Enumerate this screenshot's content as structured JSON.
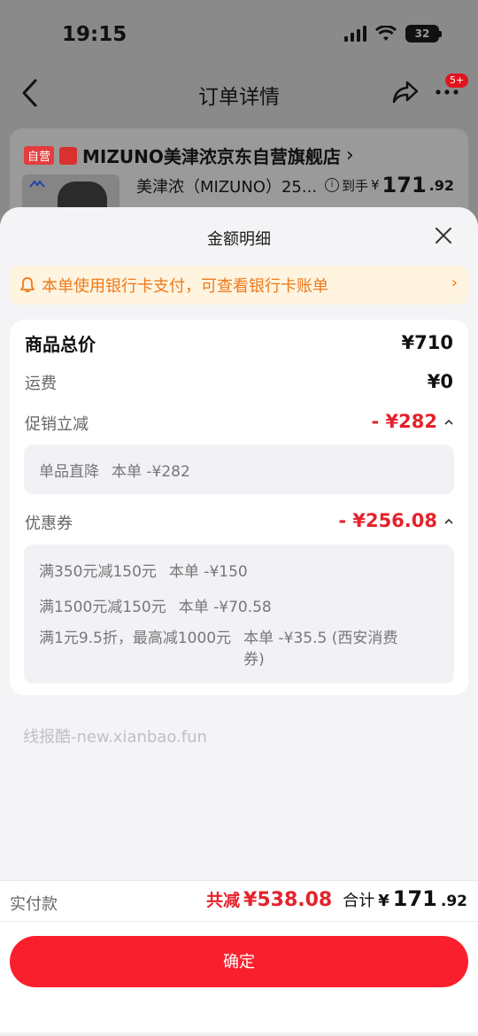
{
  "status_bar": {
    "time": "19:15",
    "battery_level": "32"
  },
  "nav": {
    "title": "订单详情",
    "more_badge": "5+"
  },
  "order": {
    "self_tag": "自营",
    "store_name": "MIZUNO美津浓京东自营旗舰店",
    "product_name": "美津浓（MIZUNO）25...",
    "price_prefix": "到手",
    "price_symbol": "¥",
    "price_int": "171",
    "price_dec": ".92"
  },
  "sheet": {
    "title": "金额明细",
    "notice": "本单使用银行卡支付，可查看银行卡账单",
    "goods_total_label": "商品总价",
    "goods_total_value": "¥710",
    "shipping_label": "运费",
    "shipping_value": "¥0",
    "promo_label": "促销立减",
    "promo_value": "- ¥282",
    "promo_items": [
      {
        "name": "单品直降",
        "amount": "本单 -¥282"
      }
    ],
    "coupon_label": "优惠券",
    "coupon_value": "- ¥256.08",
    "coupon_items": [
      {
        "name": "满350元减150元",
        "amount": "本单 -¥150"
      },
      {
        "name": "满1500元减150元",
        "amount": "本单 -¥70.58"
      },
      {
        "name": "满1元9.5折，最高减1000元",
        "amount": "本单 -¥35.5 (西安消费券)"
      }
    ],
    "watermark": "线报酷-new.xianbao.fun"
  },
  "footer": {
    "pay_label": "实付款",
    "discount_text": "共减",
    "discount_amount": "¥538.08",
    "total_label": "合计",
    "total_symbol": "¥",
    "total_int": "171",
    "total_dec": ".92",
    "confirm_label": "确定"
  },
  "colors": {
    "accent_red": "#fa1f2d",
    "notice_orange": "#ee7a1c",
    "price_red": "#e5222c"
  }
}
